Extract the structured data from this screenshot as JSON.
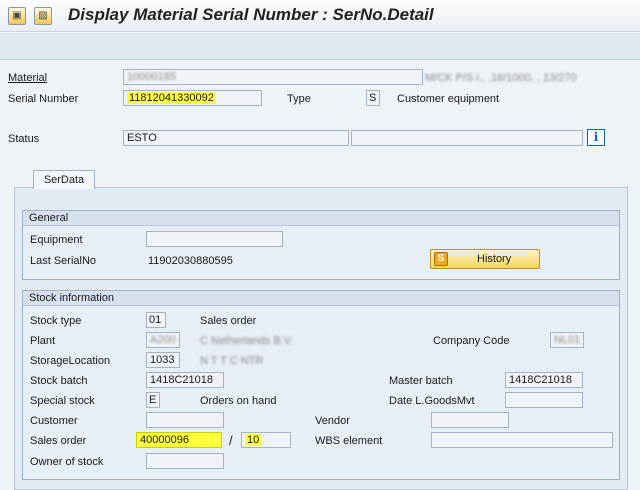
{
  "window": {
    "title": "Display Material Serial Number : SerNo.Detail"
  },
  "header": {
    "material_label": "Material",
    "material_value": "10000185",
    "material_desc": "M/CK P/S i., .16/1000, , 13/270",
    "serial_label": "Serial Number",
    "serial_value": "11812041330092",
    "type_label": "Type",
    "type_value": "S",
    "type_desc": "Customer equipment",
    "status_label": "Status",
    "status_value": "ESTO",
    "status_value2": ""
  },
  "tabs": [
    {
      "label": "SerData",
      "active": true
    }
  ],
  "general": {
    "heading": "General",
    "equipment_label": "Equipment",
    "equipment_value": "",
    "last_serial_label": "Last SerialNo",
    "last_serial_value": "11902030880595",
    "history_button": "History"
  },
  "stock": {
    "heading": "Stock information",
    "stock_type_label": "Stock type",
    "stock_type_value": "01",
    "stock_type_desc": "Sales order",
    "plant_label": "Plant",
    "plant_value": "A200",
    "plant_desc": "C  Netherlands B.V.",
    "company_code_label": "Company Code",
    "company_code_value": "NL01",
    "storage_location_label": "StorageLocation",
    "storage_location_value": "1033",
    "storage_location_desc": "N  T   T  C NTR",
    "stock_batch_label": "Stock batch",
    "stock_batch_value": "1418C21018",
    "master_batch_label": "Master batch",
    "master_batch_value": "1418C21018",
    "special_stock_label": "Special stock",
    "special_stock_value": "E",
    "special_stock_desc": "Orders on hand",
    "date_goods_label": "Date L.GoodsMvt",
    "date_goods_value": "",
    "customer_label": "Customer",
    "customer_value": "",
    "vendor_label": "Vendor",
    "vendor_value": "",
    "sales_order_label": "Sales order",
    "sales_order_value": "40000096",
    "sales_order_sep": "/",
    "sales_order_item": "10",
    "wbs_label": "WBS element",
    "wbs_value": "",
    "owner_label": "Owner of stock",
    "owner_value": ""
  },
  "icons": {
    "menu": "system-menu-icon",
    "save": "save-icon",
    "info": "info-icon",
    "history": "history-icon"
  },
  "colors": {
    "highlight": "#fcff3c",
    "history_button": "#f5d35c",
    "background": "#eef3f8"
  }
}
